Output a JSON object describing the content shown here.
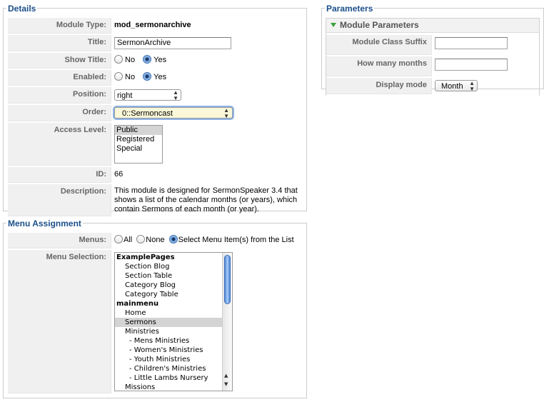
{
  "details": {
    "legend": "Details",
    "module_type_label": "Module Type:",
    "module_type_value": "mod_sermonarchive",
    "title_label": "Title:",
    "title_value": "SermonArchive",
    "show_title_label": "Show Title:",
    "show_title_no": "No",
    "show_title_yes": "Yes",
    "enabled_label": "Enabled:",
    "enabled_no": "No",
    "enabled_yes": "Yes",
    "position_label": "Position:",
    "position_value": "right",
    "order_label": "Order:",
    "order_value": "0::Sermoncast",
    "access_label": "Access Level:",
    "access_options": [
      "Public",
      "Registered",
      "Special"
    ],
    "id_label": "ID:",
    "id_value": "66",
    "description_label": "Description:",
    "description_value": "This module is designed for SermonSpeaker 3.4 that shows a list of the calendar months (or years), which contain Sermons of each month (or year)."
  },
  "menu_assignment": {
    "legend": "Menu Assignment",
    "menus_label": "Menus:",
    "menus_all": "All",
    "menus_none": "None",
    "menus_select": "Select Menu Item(s) from the List",
    "menu_selection_label": "Menu Selection:",
    "items": [
      {
        "text": "ExamplePages",
        "kind": "group"
      },
      {
        "text": "Section Blog",
        "kind": "ind1"
      },
      {
        "text": "Section Table",
        "kind": "ind1"
      },
      {
        "text": "Category Blog",
        "kind": "ind1"
      },
      {
        "text": "Category Table",
        "kind": "ind1"
      },
      {
        "text": "mainmenu",
        "kind": "group"
      },
      {
        "text": "Home",
        "kind": "ind1"
      },
      {
        "text": "Sermons",
        "kind": "ind1",
        "selected": true
      },
      {
        "text": "Ministries",
        "kind": "ind1"
      },
      {
        "text": "- Mens Ministries",
        "kind": "ind2"
      },
      {
        "text": "- Women's Ministries",
        "kind": "ind2"
      },
      {
        "text": "- Youth Ministries",
        "kind": "ind2"
      },
      {
        "text": "- Children's Ministries",
        "kind": "ind2"
      },
      {
        "text": "- Little Lambs Nursery",
        "kind": "ind2"
      },
      {
        "text": "Missions",
        "kind": "ind1"
      }
    ]
  },
  "parameters": {
    "legend": "Parameters",
    "panel_title": "Module Parameters",
    "class_suffix_label": "Module Class Suffix",
    "class_suffix_value": "",
    "months_label": "How many months",
    "months_value": "",
    "display_mode_label": "Display mode",
    "display_mode_value": "Month"
  },
  "colors": {
    "legend_text": "#1b4f8a",
    "key_bg": "#f0f0f0",
    "order_select_bg": "#fbf7d9",
    "focus_ring": "#8fb4e8"
  }
}
